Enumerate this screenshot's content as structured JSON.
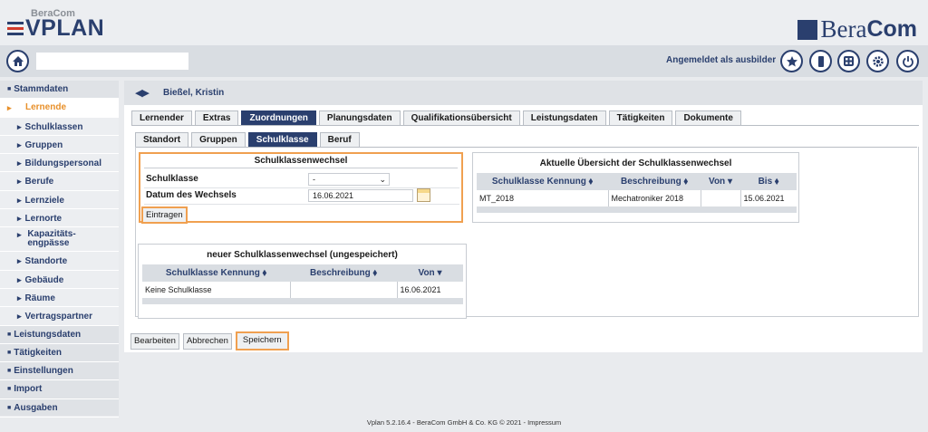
{
  "header": {
    "logo_small": "BeraCom",
    "logo_main": "VPLAN",
    "brand_light": "Bera",
    "brand_bold": "Com"
  },
  "topbar": {
    "search_value": "",
    "logged_in_text": "Angemeldet als ausbilder"
  },
  "sidebar": {
    "items": [
      {
        "label": "Stammdaten"
      },
      {
        "label": "Lernende"
      },
      {
        "label": "Schulklassen"
      },
      {
        "label": "Gruppen"
      },
      {
        "label": "Bildungspersonal"
      },
      {
        "label": "Berufe"
      },
      {
        "label": "Lernziele"
      },
      {
        "label": "Lernorte"
      },
      {
        "label": "Kapazitäts-\nengpässe"
      },
      {
        "label": "Standorte"
      },
      {
        "label": "Gebäude"
      },
      {
        "label": "Räume"
      },
      {
        "label": "Vertragspartner"
      },
      {
        "label": "Leistungsdaten"
      },
      {
        "label": "Tätigkeiten"
      },
      {
        "label": "Einstellungen"
      },
      {
        "label": "Import"
      },
      {
        "label": "Ausgaben"
      }
    ],
    "kapazitaet_line1": "Kapazitäts-",
    "kapazitaet_line2": "engpässe"
  },
  "person": {
    "name": "Bießel, Kristin"
  },
  "tabs_main": [
    "Lernender",
    "Extras",
    "Zuordnungen",
    "Planungsdaten",
    "Qualifikationsübersicht",
    "Leistungsdaten",
    "Tätigkeiten",
    "Dokumente"
  ],
  "tabs_sub": [
    "Standort",
    "Gruppen",
    "Schulklasse",
    "Beruf"
  ],
  "form": {
    "title": "Schulklassenwechsel",
    "schulklasse_label": "Schulklasse",
    "schulklasse_value": "-",
    "datum_label": "Datum des Wechsels",
    "datum_value": "16.06.2021",
    "eintragen": "Eintragen"
  },
  "overview": {
    "title": "Aktuelle Übersicht der Schulklassenwechsel",
    "headers": [
      "Schulklasse Kennung ⬧",
      "Beschreibung ⬧",
      "Von ▾",
      "Bis ⬧"
    ],
    "row": [
      "MT_2018",
      "Mechatroniker 2018",
      "",
      "15.06.2021"
    ]
  },
  "unsaved": {
    "title": "neuer Schulklassenwechsel (ungespeichert)",
    "headers": [
      "Schulklasse Kennung ⬧",
      "Beschreibung ⬧",
      "Von ▾"
    ],
    "row": [
      "Keine Schulklasse",
      "",
      "16.06.2021"
    ]
  },
  "buttons": {
    "bearbeiten": "Bearbeiten",
    "abbrechen": "Abbrechen",
    "speichern": "Speichern"
  },
  "footer": "Vplan 5.2.16.4 - BeraCom GmbH & Co. KG © 2021 - Impressum",
  "colors": {
    "primary": "#2a3f6e",
    "accent": "#e8902a",
    "highlight": "#f0a050"
  }
}
